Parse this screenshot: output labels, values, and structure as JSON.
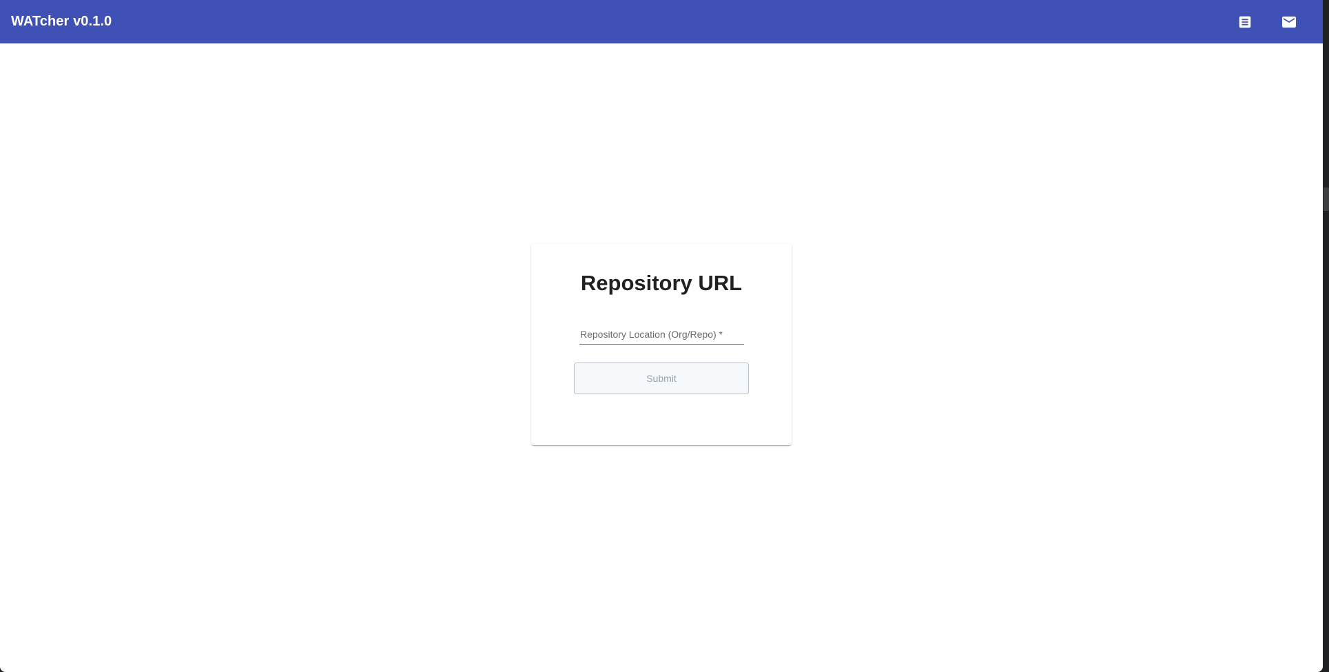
{
  "header": {
    "title": "WATcher v0.1.0",
    "icons": {
      "logs": "article-icon",
      "mail": "mail-icon"
    },
    "color": "#3f51b5"
  },
  "card": {
    "title": "Repository URL",
    "field": {
      "label": "Repository Location (Org/Repo) *",
      "value": ""
    },
    "submit_label": "Submit"
  }
}
